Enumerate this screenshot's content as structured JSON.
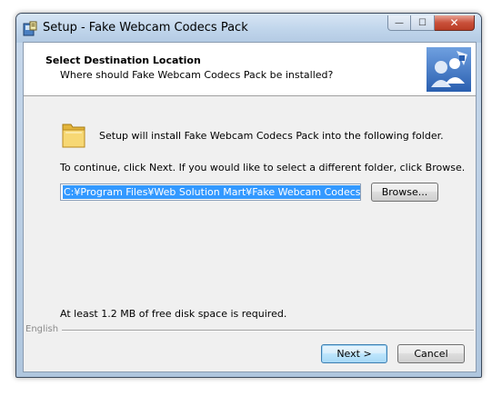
{
  "window": {
    "title": "Setup - Fake Webcam Codecs Pack",
    "controls": {
      "minimize": "—",
      "maximize": "☐",
      "close": "✕"
    }
  },
  "header": {
    "title": "Select Destination Location",
    "subtitle": "Where should Fake Webcam Codecs Pack be installed?"
  },
  "body": {
    "intro": "Setup will install Fake Webcam Codecs Pack into the following folder.",
    "continue_text": "To continue, click Next. If you would like to select a different folder, click Browse.",
    "path_value": "C:¥Program Files¥Web Solution Mart¥Fake Webcam Codecs Pack",
    "browse_label": "Browse...",
    "space_text": "At least 1.2 MB of free disk space is required."
  },
  "footer": {
    "language": "English",
    "next_label": "Next >",
    "cancel_label": "Cancel"
  },
  "colors": {
    "selection": "#3399ff",
    "dialog_bg": "#f0f0f0",
    "titlebar": "#c0d5eb",
    "close_button": "#c9503a"
  },
  "icons": {
    "app": "setup-app-icon",
    "header": "wizard-header-icon",
    "folder": "folder-icon"
  }
}
